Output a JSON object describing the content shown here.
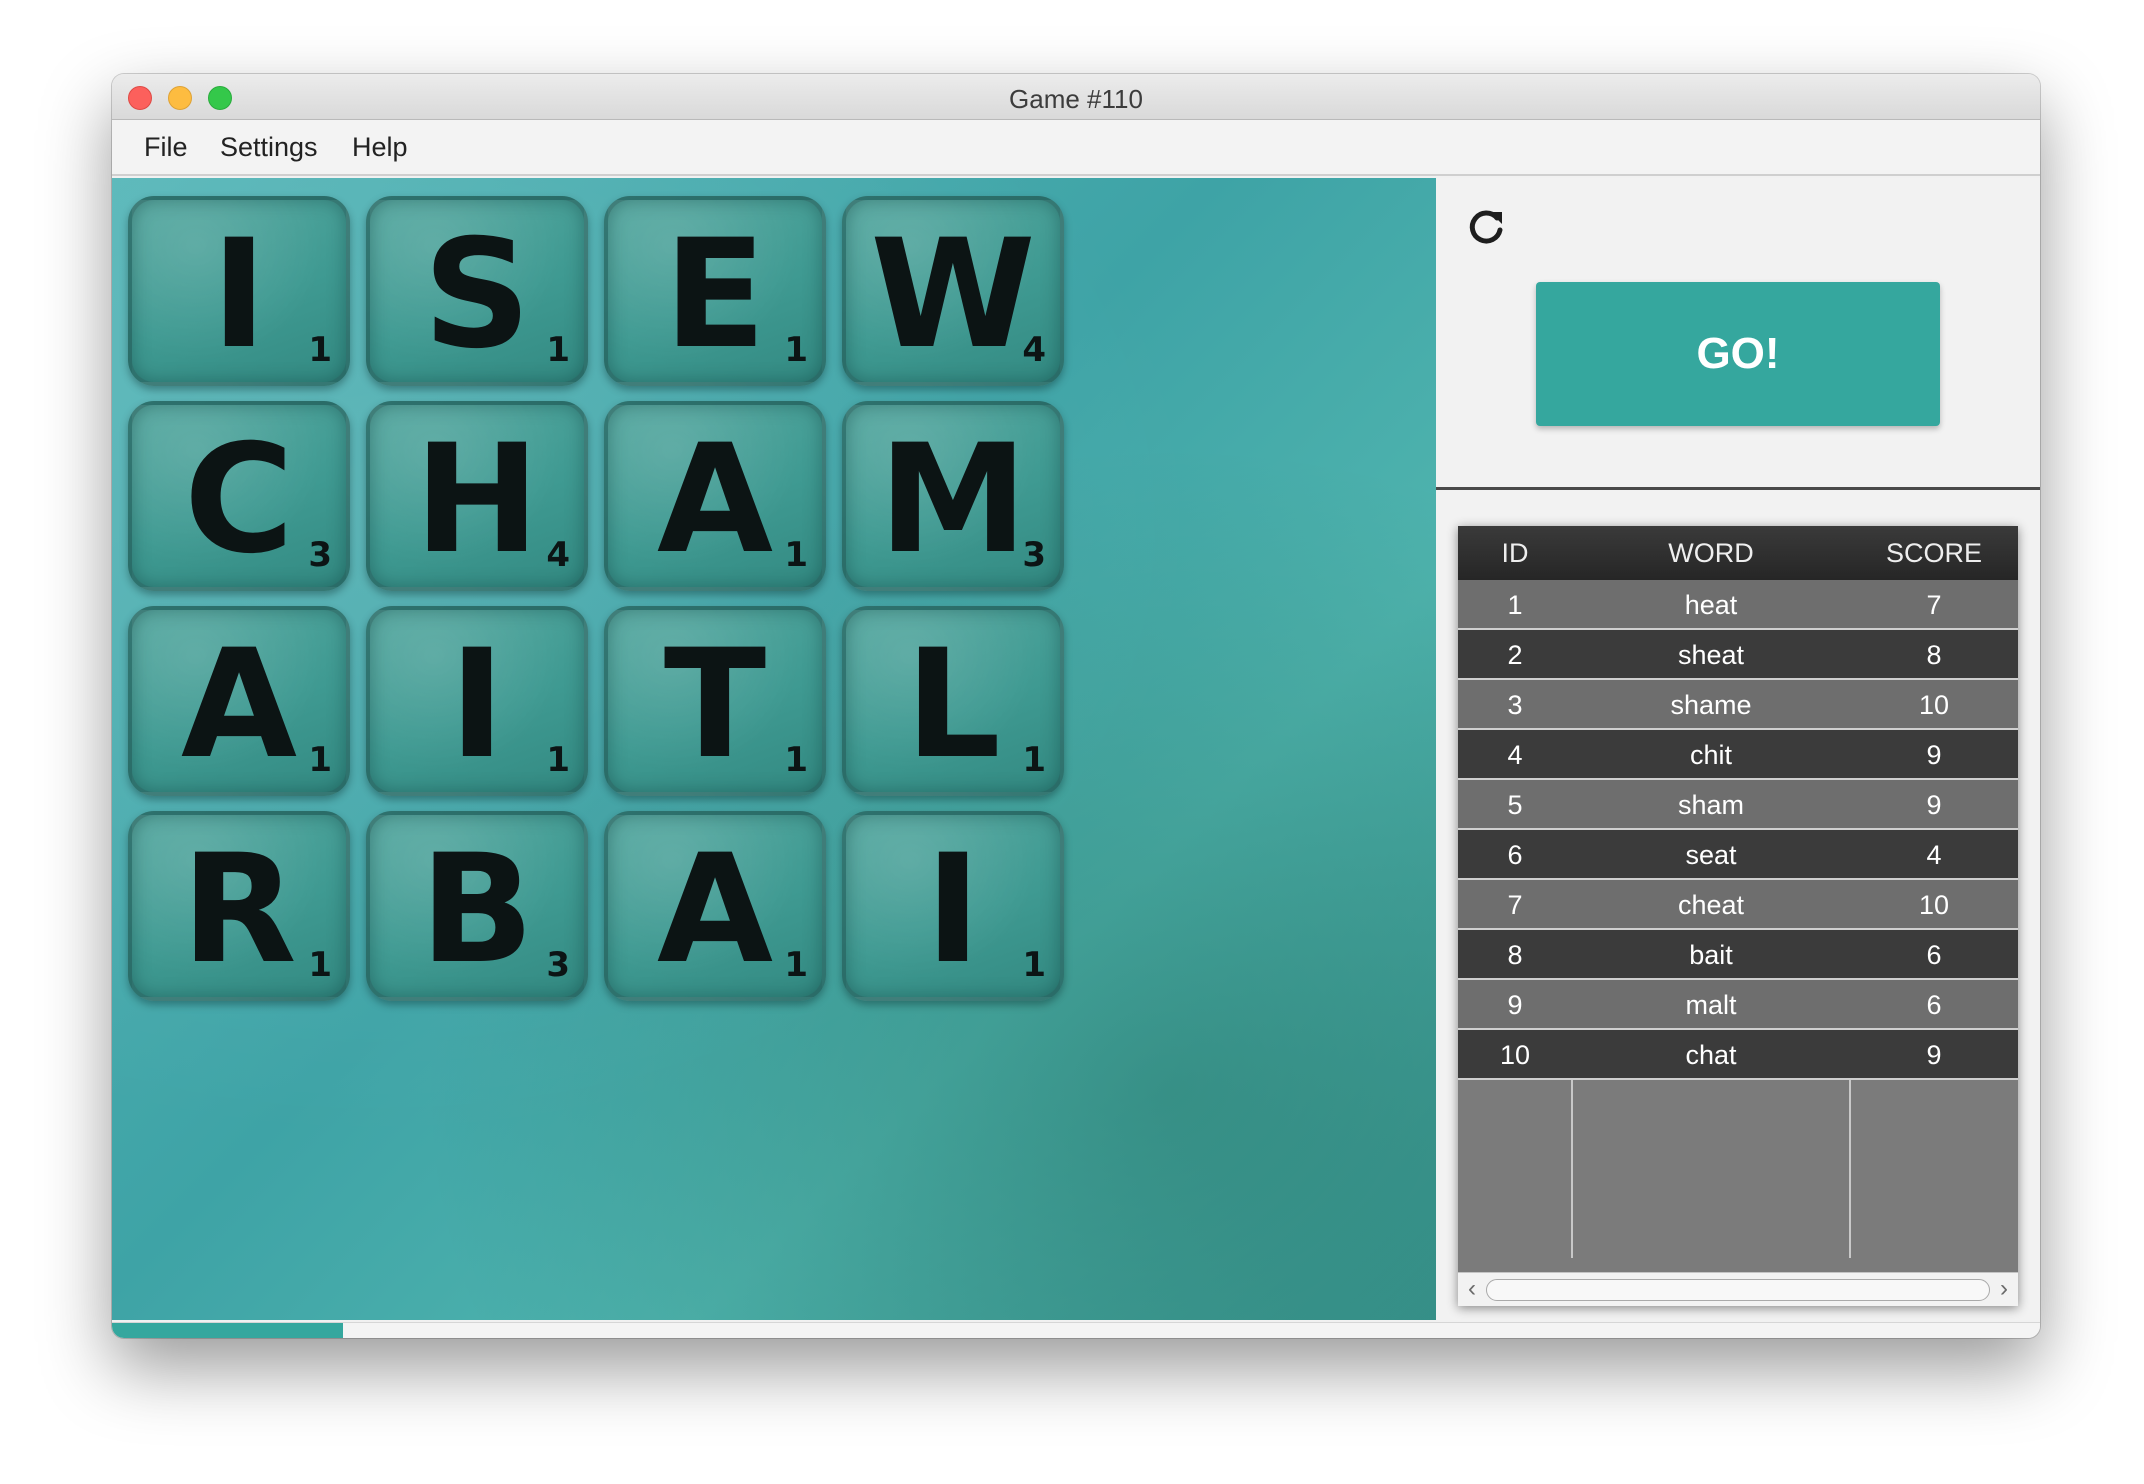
{
  "window": {
    "title": "Game #110"
  },
  "menu": {
    "items": [
      "File",
      "Settings",
      "Help"
    ]
  },
  "board": {
    "tiles": [
      {
        "letter": "I",
        "points": "1"
      },
      {
        "letter": "S",
        "points": "1"
      },
      {
        "letter": "E",
        "points": "1"
      },
      {
        "letter": "W",
        "points": "4"
      },
      {
        "letter": "C",
        "points": "3"
      },
      {
        "letter": "H",
        "points": "4"
      },
      {
        "letter": "A",
        "points": "1"
      },
      {
        "letter": "M",
        "points": "3"
      },
      {
        "letter": "A",
        "points": "1"
      },
      {
        "letter": "I",
        "points": "1"
      },
      {
        "letter": "T",
        "points": "1"
      },
      {
        "letter": "L",
        "points": "1"
      },
      {
        "letter": "R",
        "points": "1"
      },
      {
        "letter": "B",
        "points": "3"
      },
      {
        "letter": "A",
        "points": "1"
      },
      {
        "letter": "I",
        "points": "1"
      }
    ]
  },
  "controls": {
    "go_label": "GO!",
    "refresh_icon": "refresh-icon"
  },
  "table": {
    "headers": {
      "id": "ID",
      "word": "WORD",
      "score": "SCORE"
    },
    "rows": [
      {
        "id": "1",
        "word": "heat",
        "score": "7"
      },
      {
        "id": "2",
        "word": "sheat",
        "score": "8"
      },
      {
        "id": "3",
        "word": "shame",
        "score": "10"
      },
      {
        "id": "4",
        "word": "chit",
        "score": "9"
      },
      {
        "id": "5",
        "word": "sham",
        "score": "9"
      },
      {
        "id": "6",
        "word": "seat",
        "score": "4"
      },
      {
        "id": "7",
        "word": "cheat",
        "score": "10"
      },
      {
        "id": "8",
        "word": "bait",
        "score": "6"
      },
      {
        "id": "9",
        "word": "malt",
        "score": "6"
      },
      {
        "id": "10",
        "word": "chat",
        "score": "9"
      }
    ]
  },
  "progress": {
    "fraction": 0.12,
    "color": "#35a79e"
  },
  "colors": {
    "accent": "#35a79e"
  }
}
